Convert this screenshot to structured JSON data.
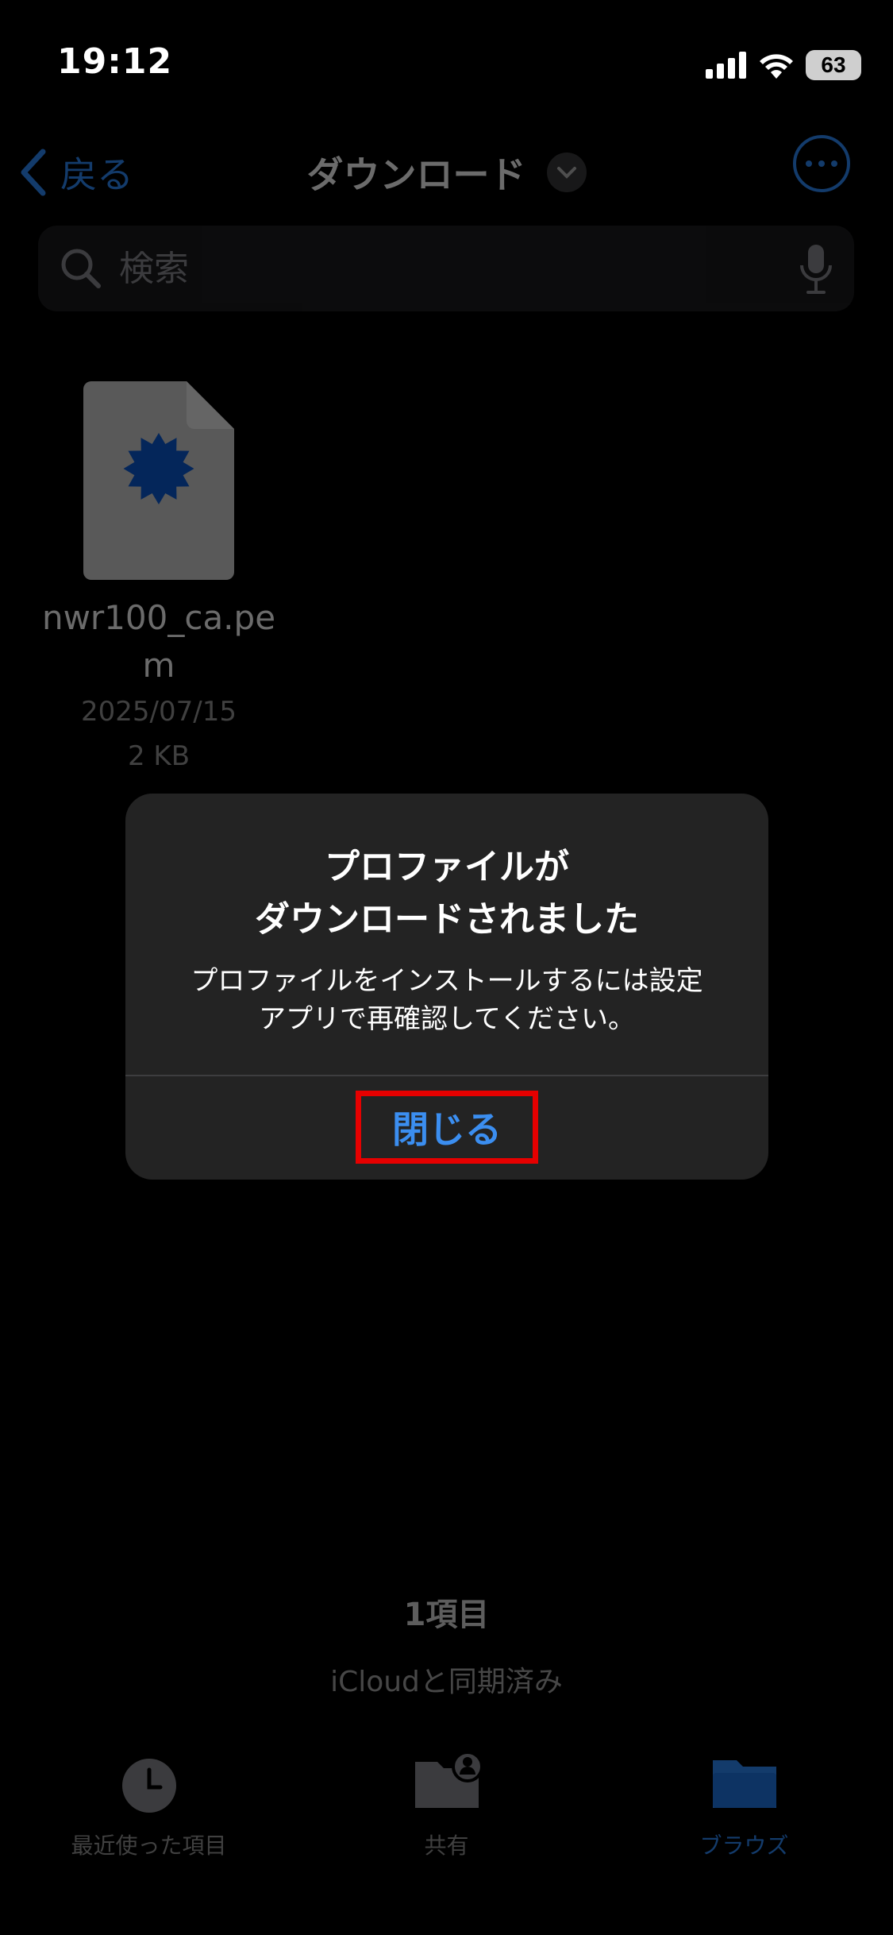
{
  "status_bar": {
    "time": "19:12",
    "battery": "63"
  },
  "nav": {
    "back_label": "戻る",
    "title": "ダウンロード"
  },
  "search": {
    "placeholder": "検索"
  },
  "files": [
    {
      "name": "nwr100_ca.pem",
      "date": "2025/07/15",
      "size": "2 KB"
    }
  ],
  "footer": {
    "item_count": "1項目",
    "sync_status": "iCloudと同期済み"
  },
  "tabs": [
    {
      "label": "最近使った項目",
      "icon": "clock-icon",
      "active": false
    },
    {
      "label": "共有",
      "icon": "shared-folder-icon",
      "active": false
    },
    {
      "label": "ブラウズ",
      "icon": "folder-icon",
      "active": true
    }
  ],
  "alert": {
    "title": "プロファイルが\nダウンロードされました",
    "message": "プロファイルをインストールするには設定\nアプリで再確認してください。",
    "button_label": "閉じる"
  },
  "colors": {
    "accent": "#2f8cff",
    "highlight_border": "#e60000",
    "dialog_bg": "#232323"
  }
}
